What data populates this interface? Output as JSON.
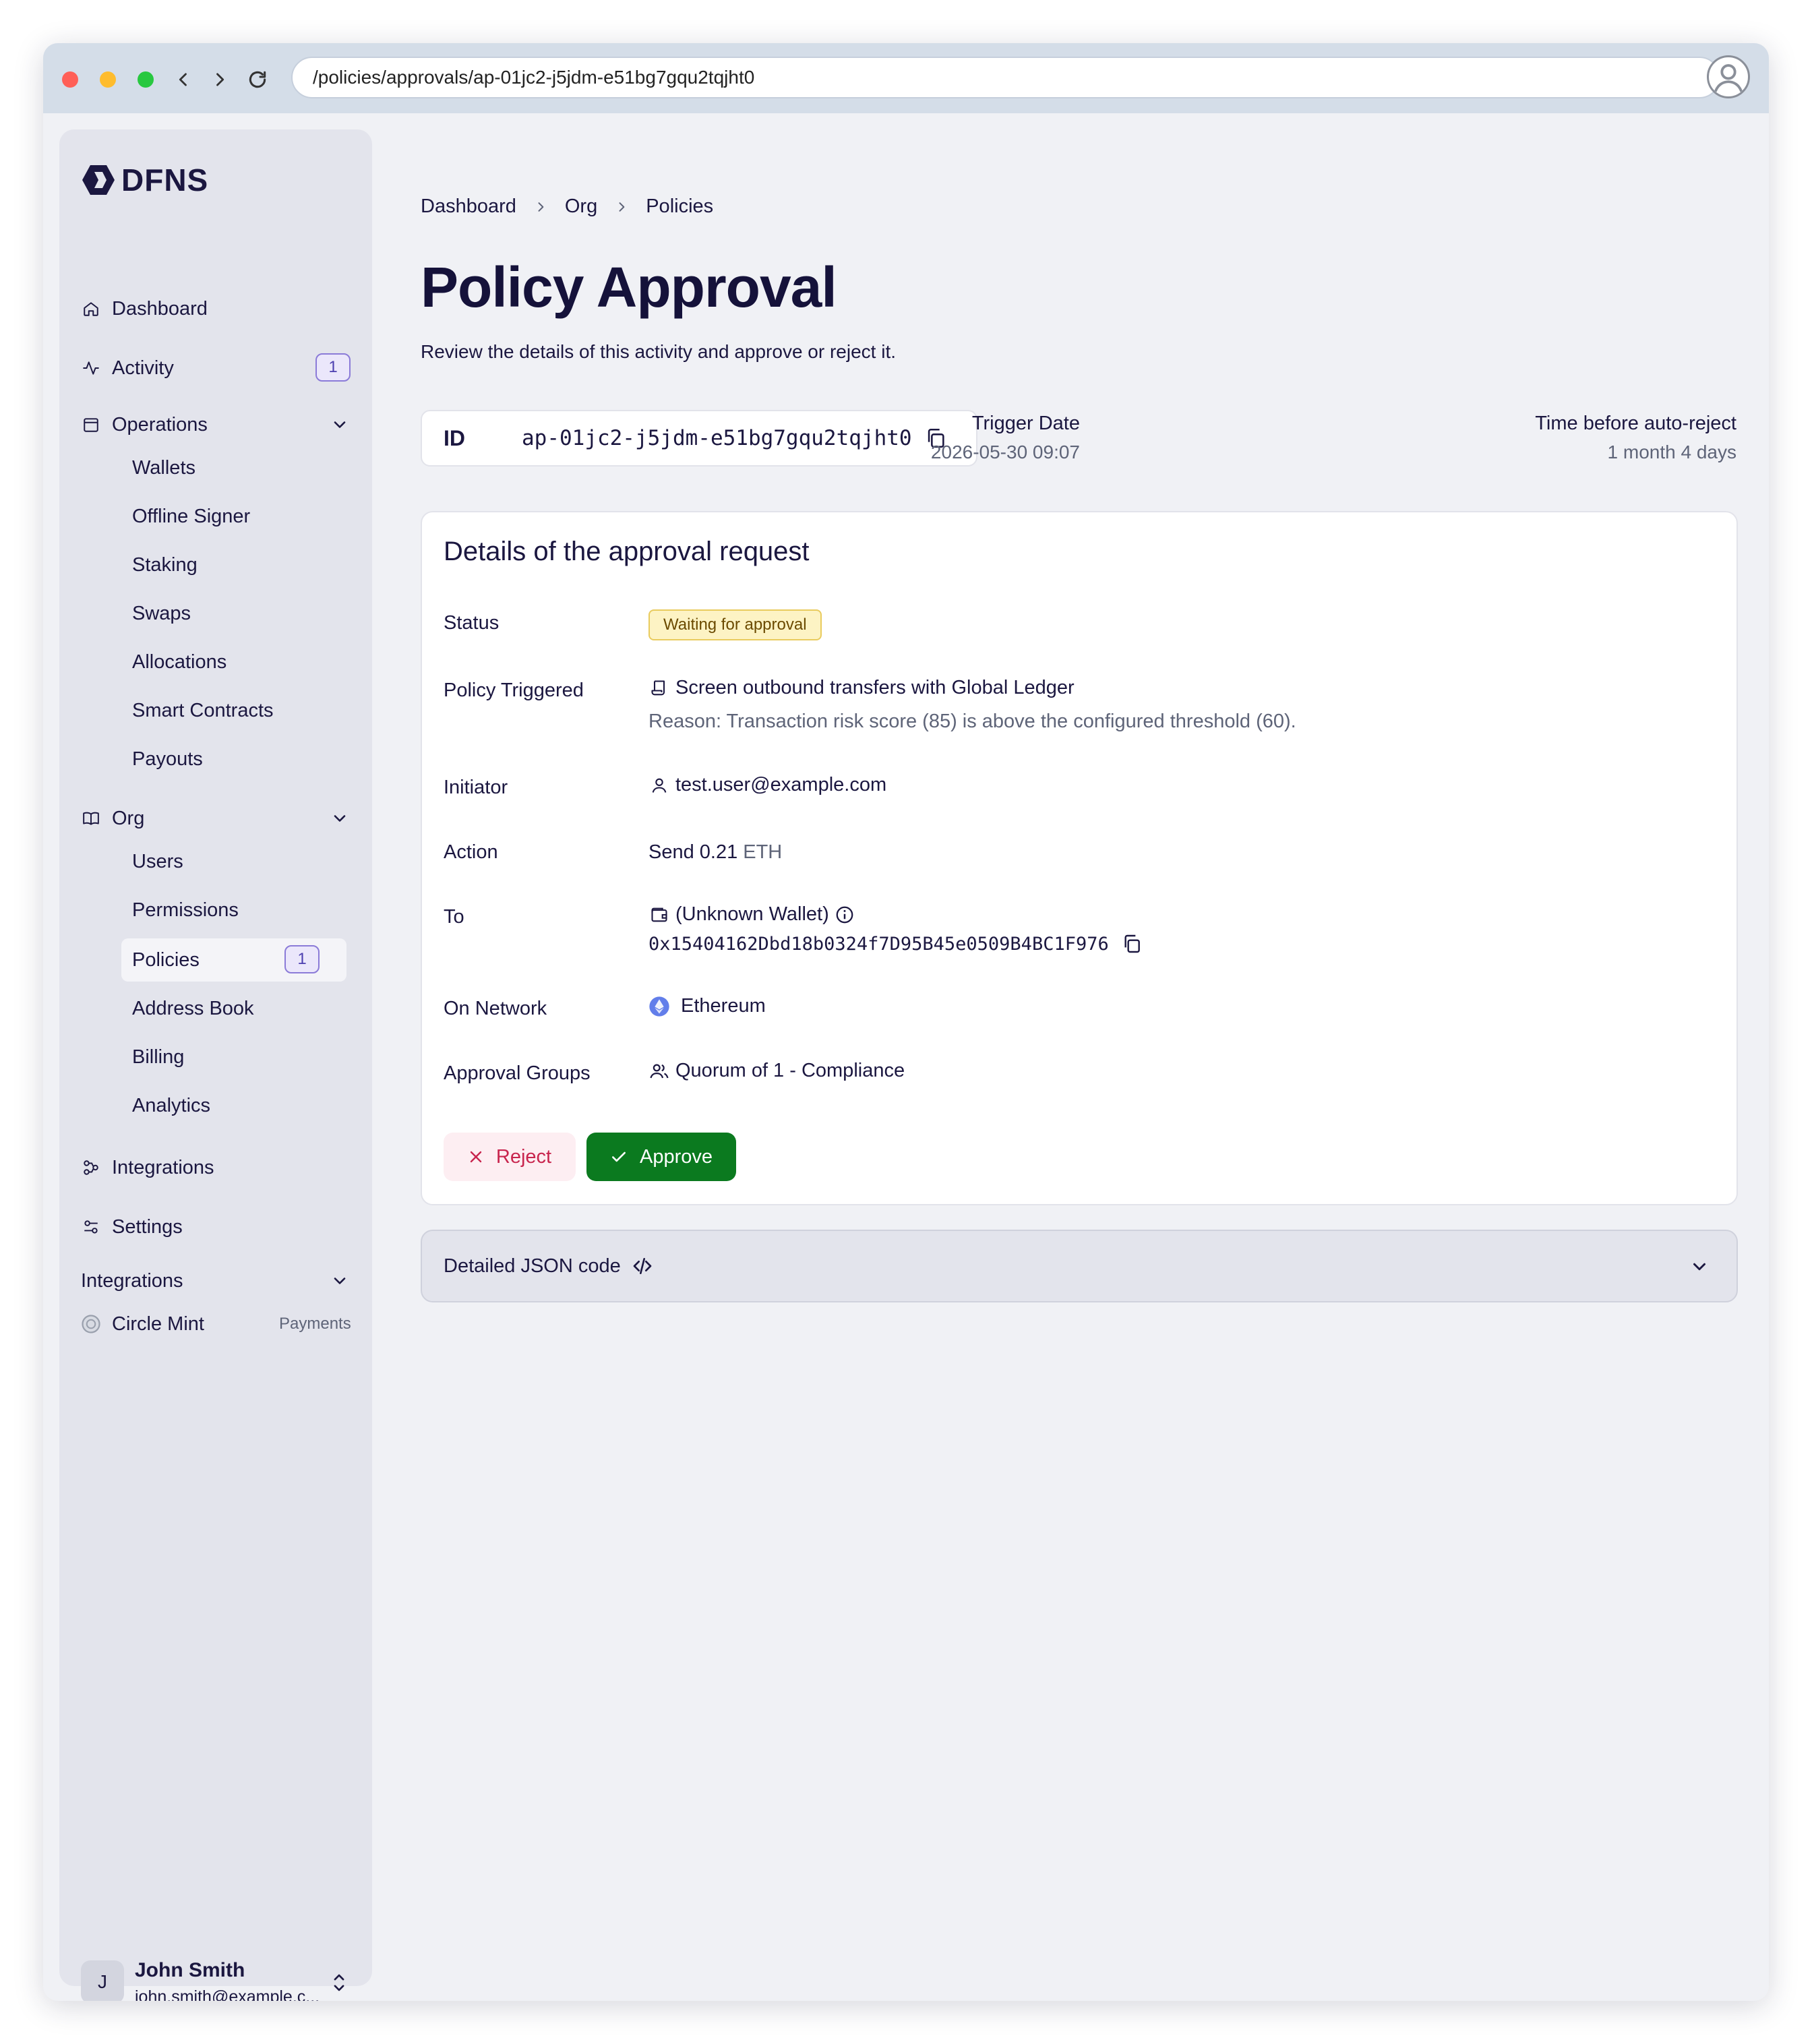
{
  "browser": {
    "url": "/policies/approvals/ap-01jc2-j5jdm-e51bg7gqu2tqjht0"
  },
  "sidebar": {
    "logo": "DFNS",
    "nav": {
      "dashboard": "Dashboard",
      "activity": "Activity",
      "activity_badge": "1",
      "operations": "Operations",
      "operations_items": [
        "Wallets",
        "Offline Signer",
        "Staking",
        "Swaps",
        "Allocations",
        "Smart Contracts",
        "Payouts"
      ],
      "org": "Org",
      "org_items": [
        "Users",
        "Permissions",
        "Policies",
        "Address Book",
        "Billing",
        "Analytics"
      ],
      "policies_badge": "1",
      "integrations": "Integrations",
      "settings": "Settings"
    },
    "integrations_section": {
      "title": "Integrations",
      "item_name": "Circle Mint",
      "item_tag": "Payments"
    },
    "user": {
      "initial": "J",
      "name": "John Smith",
      "email": "john.smith@example.c..."
    }
  },
  "breadcrumb": [
    "Dashboard",
    "Org",
    "Policies"
  ],
  "page": {
    "title": "Policy Approval",
    "subtitle": "Review the details of this activity and approve or reject it."
  },
  "id_box": {
    "label": "ID",
    "value": "ap-01jc2-j5jdm-e51bg7gqu2tqjht0"
  },
  "meta": {
    "trigger_label": "Trigger Date",
    "trigger_value": "2026-05-30 09:07",
    "autoreject_label": "Time before auto-reject",
    "autoreject_value": "1 month 4 days"
  },
  "details": {
    "title": "Details of the approval request",
    "labels": {
      "status": "Status",
      "policy": "Policy Triggered",
      "initiator": "Initiator",
      "action": "Action",
      "to": "To",
      "network": "On Network",
      "groups": "Approval Groups"
    },
    "status": "Waiting for approval",
    "policy_name": "Screen outbound transfers with Global Ledger",
    "policy_reason": "Reason: Transaction risk score (85) is above the configured threshold (60).",
    "initiator": "test.user@example.com",
    "action_prefix": "Send 0.21",
    "action_unit": "ETH",
    "to_name": "(Unknown Wallet)",
    "to_address": "0x15404162Dbd18b0324f7D95B45e0509B4BC1F976",
    "network": "Ethereum",
    "groups": "Quorum of 1 - Compliance"
  },
  "buttons": {
    "reject": "Reject",
    "approve": "Approve"
  },
  "json_panel": {
    "label": "Detailed JSON code"
  },
  "colors": {
    "approve": "#0b7a1f",
    "reject_text": "#c8254e",
    "status_bg": "#fdf3c4",
    "badge_border": "#8b7bd8"
  }
}
